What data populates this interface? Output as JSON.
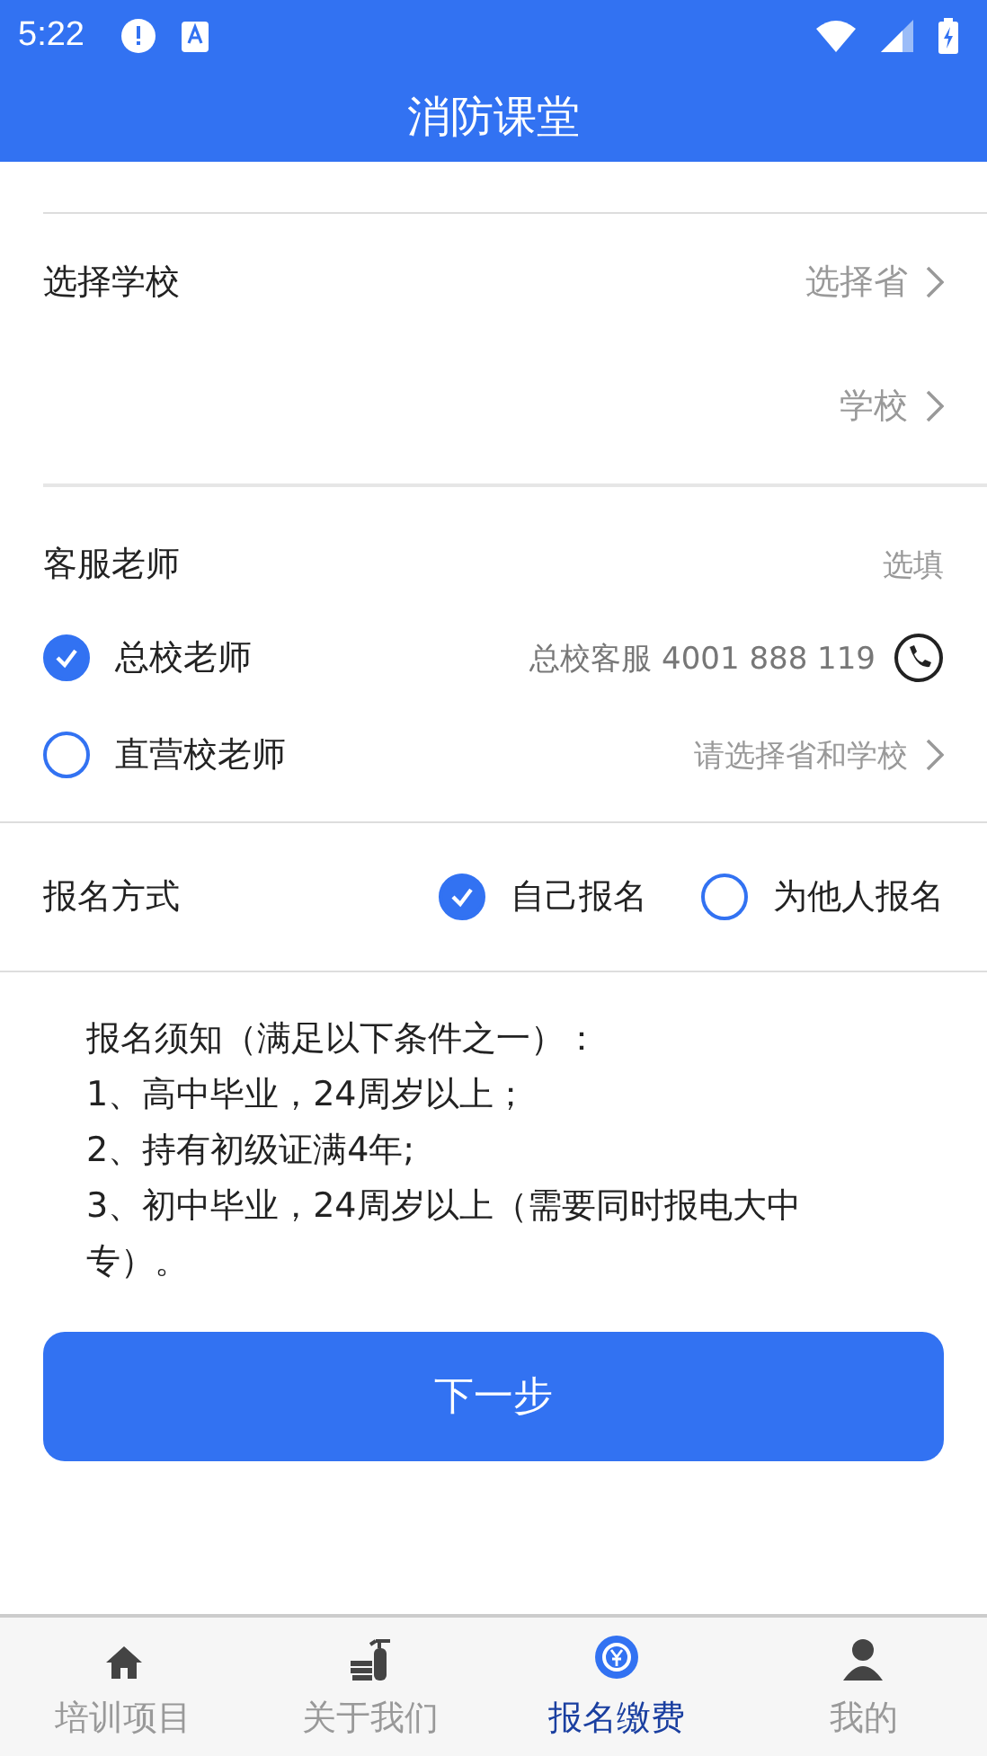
{
  "status_bar": {
    "time": "5:22"
  },
  "title": "消防课堂",
  "school": {
    "label": "选择学校",
    "province": "选择省",
    "school": "学校"
  },
  "teacher": {
    "label": "客服老师",
    "hint": "选填",
    "options": [
      {
        "label": "总校老师",
        "selected": true,
        "kind": "phone",
        "detail": "总校客服 4001 888 119"
      },
      {
        "label": "直营校老师",
        "selected": false,
        "kind": "select",
        "detail": "请选择省和学校"
      }
    ]
  },
  "signup": {
    "label": "报名方式",
    "options": [
      {
        "label": "自己报名",
        "selected": true
      },
      {
        "label": "为他人报名",
        "selected": false
      }
    ]
  },
  "notice": [
    "报名须知（满足以下条件之一）：",
    "1、高中毕业，24周岁以上；",
    "2、持有初级证满4年;",
    "3、初中毕业，24周岁以上（需要同时报电大中专）。"
  ],
  "next_button": "下一步",
  "tabs": [
    {
      "label": "培训项目",
      "selected": false,
      "kind": "home"
    },
    {
      "label": "关于我们",
      "selected": false,
      "kind": "extinguisher"
    },
    {
      "label": "报名缴费",
      "selected": true,
      "kind": "payment"
    },
    {
      "label": "我的",
      "selected": false,
      "kind": "person"
    }
  ]
}
